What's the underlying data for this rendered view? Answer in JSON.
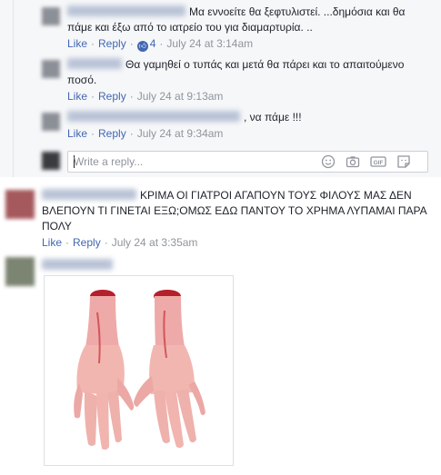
{
  "thread": {
    "replies": [
      {
        "text": "Μα εννοείτε θα ξεφτυλιστεί. ...δημόσια και θα πάμε και έξω από το ιατρείο του για διαμαρτυρία. ..",
        "like_label": "Like",
        "reply_label": "Reply",
        "reaction_count": "4",
        "timestamp": "July 24 at 3:14am"
      },
      {
        "text": "Θα γαμηθεί ο τυπάς και μετά θα πάρει και το απαιτούμενο ποσό.",
        "like_label": "Like",
        "reply_label": "Reply",
        "timestamp": "July 24 at 9:13am"
      },
      {
        "text": ", να πάμε !!!",
        "like_label": "Like",
        "reply_label": "Reply",
        "timestamp": "July 24 at 9:34am"
      }
    ],
    "reply_box": {
      "placeholder": "Write a reply..."
    }
  },
  "comments": [
    {
      "text": "ΚΡΙΜΑ ΟΙ ΓΙΑΤΡΟΙ ΑΓΑΠΟΥΝ ΤΟΥΣ ΦΙΛΟΥΣ ΜΑΣ ΔΕΝ ΒΛΕΠΟΥΝ ΤΙ ΓΙΝΕΤΑΙ ΕΞΩ;ΟΜΩΣ ΕΔΩ ΠΑΝΤΟΥ ΤΟ ΧΡΗΜΑ ΛΥΠΑΜΑΙ ΠΑΡΑ ΠΟΛΥ",
      "like_label": "Like",
      "reply_label": "Reply",
      "timestamp": "July 24 at 3:35am"
    },
    {
      "image_icon": "severed-hands-photo"
    }
  ],
  "icons": {
    "reply_box": [
      "smiley-icon",
      "camera-icon",
      "gif-icon",
      "sticker-icon"
    ]
  },
  "colors": {
    "link": "#4267b2",
    "meta": "#90949c",
    "thread_bg": "#f6f7f9"
  }
}
